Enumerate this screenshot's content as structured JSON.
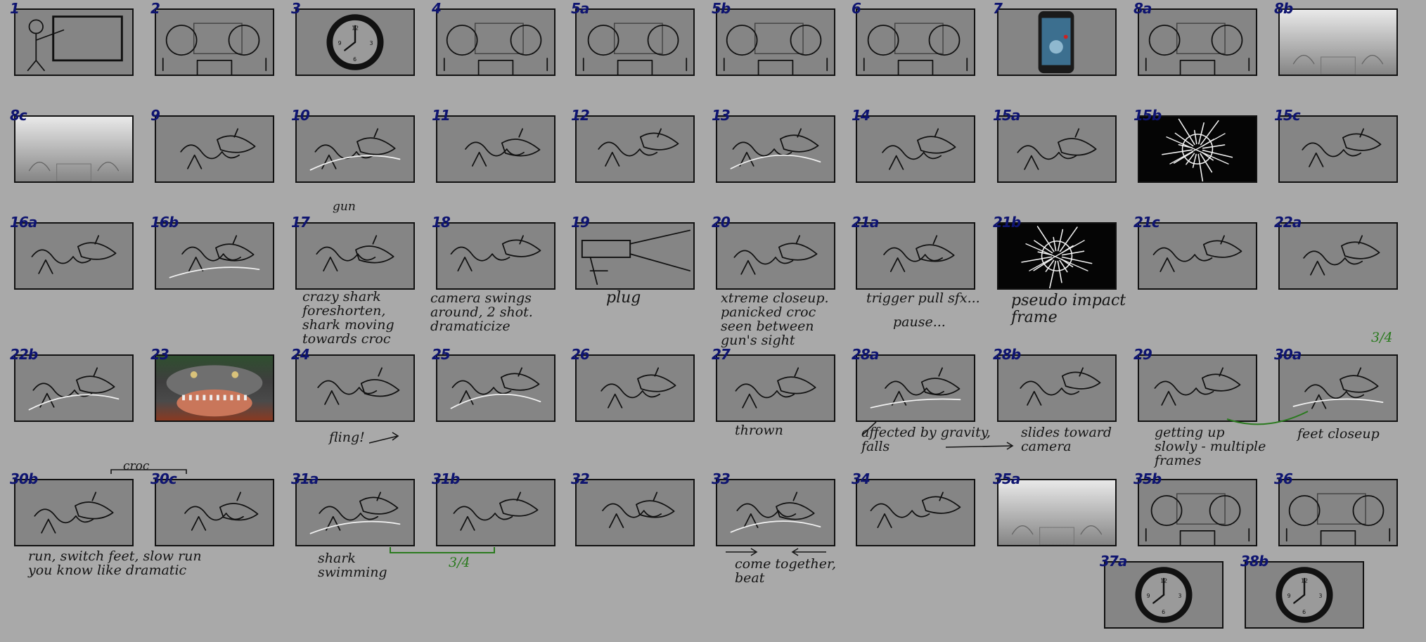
{
  "panels": [
    {
      "label": "1",
      "type": "classroom-teacher-sketch"
    },
    {
      "label": "2",
      "type": "classroom-students-sketch"
    },
    {
      "label": "3",
      "type": "wall-clock"
    },
    {
      "label": "4",
      "type": "classroom-students-sketch"
    },
    {
      "label": "5a",
      "type": "classroom-students-sketch"
    },
    {
      "label": "5b",
      "type": "classroom-students-sketch"
    },
    {
      "label": "6",
      "type": "classroom-students-sketch"
    },
    {
      "label": "7",
      "type": "phone-closeup"
    },
    {
      "label": "8a",
      "type": "classroom-students-sketch"
    },
    {
      "label": "8b",
      "type": "fade-to-white"
    },
    {
      "label": "8c",
      "type": "fade-to-white"
    },
    {
      "label": "9",
      "type": "croc-and-shark-sketch"
    },
    {
      "label": "10",
      "type": "croc-and-shark-sketch"
    },
    {
      "label": "11",
      "type": "croc-and-shark-sketch"
    },
    {
      "label": "12",
      "type": "croc-and-shark-sketch"
    },
    {
      "label": "13",
      "type": "croc-and-shark-sketch"
    },
    {
      "label": "14",
      "type": "croc-and-shark-sketch"
    },
    {
      "label": "15a",
      "type": "croc-and-shark-sketch"
    },
    {
      "label": "15b",
      "type": "impact-frame"
    },
    {
      "label": "15c",
      "type": "croc-and-shark-sketch"
    },
    {
      "label": "16a",
      "type": "croc-and-shark-sketch"
    },
    {
      "label": "16b",
      "type": "croc-and-shark-sketch"
    },
    {
      "label": "17",
      "type": "croc-and-shark-sketch"
    },
    {
      "label": "18",
      "type": "croc-and-shark-sketch"
    },
    {
      "label": "19",
      "type": "gun-sketch"
    },
    {
      "label": "20",
      "type": "croc-and-shark-sketch"
    },
    {
      "label": "21a",
      "type": "croc-and-shark-sketch"
    },
    {
      "label": "21b",
      "type": "impact-frame"
    },
    {
      "label": "21c",
      "type": "croc-and-shark-sketch"
    },
    {
      "label": "22a",
      "type": "croc-and-shark-sketch"
    },
    {
      "label": "22b",
      "type": "croc-and-shark-sketch"
    },
    {
      "label": "23",
      "type": "crocodile-photo"
    },
    {
      "label": "24",
      "type": "croc-and-shark-sketch"
    },
    {
      "label": "25",
      "type": "croc-and-shark-sketch"
    },
    {
      "label": "26",
      "type": "croc-and-shark-sketch"
    },
    {
      "label": "27",
      "type": "croc-and-shark-sketch"
    },
    {
      "label": "28a",
      "type": "croc-and-shark-sketch"
    },
    {
      "label": "28b",
      "type": "croc-and-shark-sketch"
    },
    {
      "label": "29",
      "type": "croc-and-shark-sketch"
    },
    {
      "label": "30a",
      "type": "croc-and-shark-sketch"
    },
    {
      "label": "30b",
      "type": "croc-and-shark-sketch"
    },
    {
      "label": "30c",
      "type": "croc-and-shark-sketch"
    },
    {
      "label": "31a",
      "type": "croc-and-shark-sketch"
    },
    {
      "label": "31b",
      "type": "croc-and-shark-sketch"
    },
    {
      "label": "32",
      "type": "croc-and-shark-sketch"
    },
    {
      "label": "33",
      "type": "croc-and-shark-sketch"
    },
    {
      "label": "34",
      "type": "croc-and-shark-sketch"
    },
    {
      "label": "35a",
      "type": "fade-to-white"
    },
    {
      "label": "35b",
      "type": "classroom-students-sketch"
    },
    {
      "label": "36",
      "type": "classroom-students-sketch"
    },
    {
      "label": "37a",
      "type": "wall-clock"
    },
    {
      "label": "38b",
      "type": "wall-clock"
    }
  ],
  "notes": {
    "n17_top": "gun",
    "n17": "crazy shark\n      foreshorten,\n shark moving\ntowards croc",
    "n18": "camera swings\n  around, 2 shot.\n     dramaticize",
    "n19": "plug",
    "n20": "xtreme closeup.\npanicked croc\nseen between\ngun's sight",
    "n21a": "trigger pull sfx...",
    "n21a_2": "pause...",
    "n21b": "pseudo impact\n       frame",
    "n30a_top": "3/4",
    "n24": "fling!",
    "n27": "thrown",
    "n28a": "affected by gravity,\nfalls",
    "n28b": "slides toward\n   camera",
    "n29": "getting up\n slowly - multiple\nframes",
    "n30a": "feet closeup",
    "n30bc_top": "croc",
    "n30b": "run, switch feet, slow run\n you   know like dramatic",
    "n31": "shark\n         swimming",
    "n31_green": "3/4",
    "n33": "come together,\n      beat"
  },
  "colors": {
    "background": "#a9a9a9",
    "panel": "#858585",
    "panel_number": "#0e1470",
    "annotation": "#151515",
    "green_annotation": "#2a7a1e"
  }
}
